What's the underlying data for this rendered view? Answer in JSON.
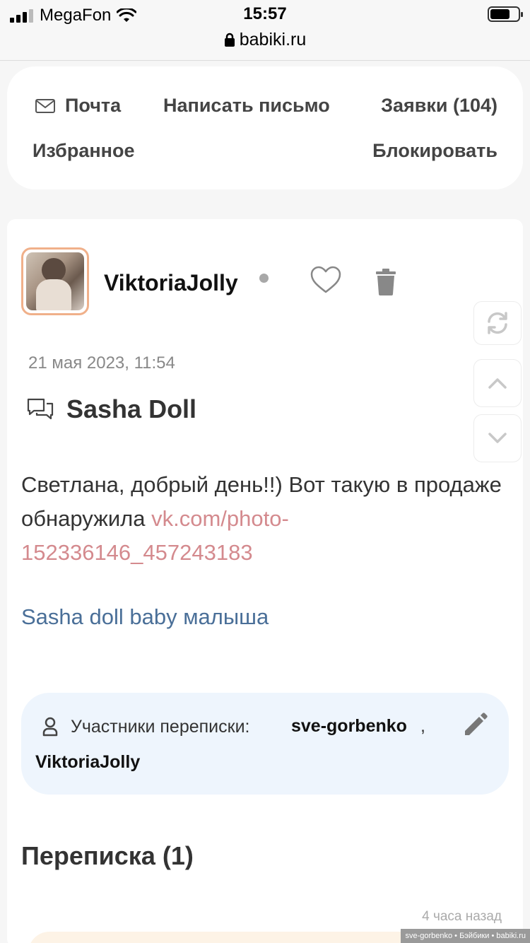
{
  "status_bar": {
    "carrier": "MegaFon",
    "time": "15:57",
    "url": "babiki.ru"
  },
  "nav": {
    "mail": "Почта",
    "write": "Написать письмо",
    "requests": "Заявки (104)",
    "favorites": "Избранное",
    "block": "Блокировать"
  },
  "message": {
    "author": "ViktoriaJolly",
    "date": "21 мая 2023, 11:54",
    "subject": "Sasha Doll",
    "body_text": "Светлана, добрый день!!) Вот такую в продаже обнаружила ",
    "body_link": "vk.com/photo-152336146_457243183",
    "tagline": "Sasha doll baby малыша"
  },
  "participants": {
    "label": "Участники переписки:",
    "user1": "sve-gorbenko",
    "separator": ",",
    "user2": "ViktoriaJolly"
  },
  "thread": {
    "title": "Переписка (1)",
    "time_ago": "4 часа назад"
  },
  "footer": {
    "credit": "sve-gorbenko • Бэйбики • babiki.ru"
  },
  "colors": {
    "link": "#d48a8e",
    "tag_link": "#4a6f98",
    "avatar_border": "#f0b08a",
    "participants_bg": "#eef5fd"
  },
  "icons": [
    "signal-icon",
    "wifi-icon",
    "lock-icon",
    "battery-icon",
    "envelope-icon",
    "heart-icon",
    "trash-icon",
    "chat-icon",
    "person-icon",
    "pencil-icon",
    "refresh-icon",
    "chevron-up-icon",
    "chevron-down-icon"
  ]
}
